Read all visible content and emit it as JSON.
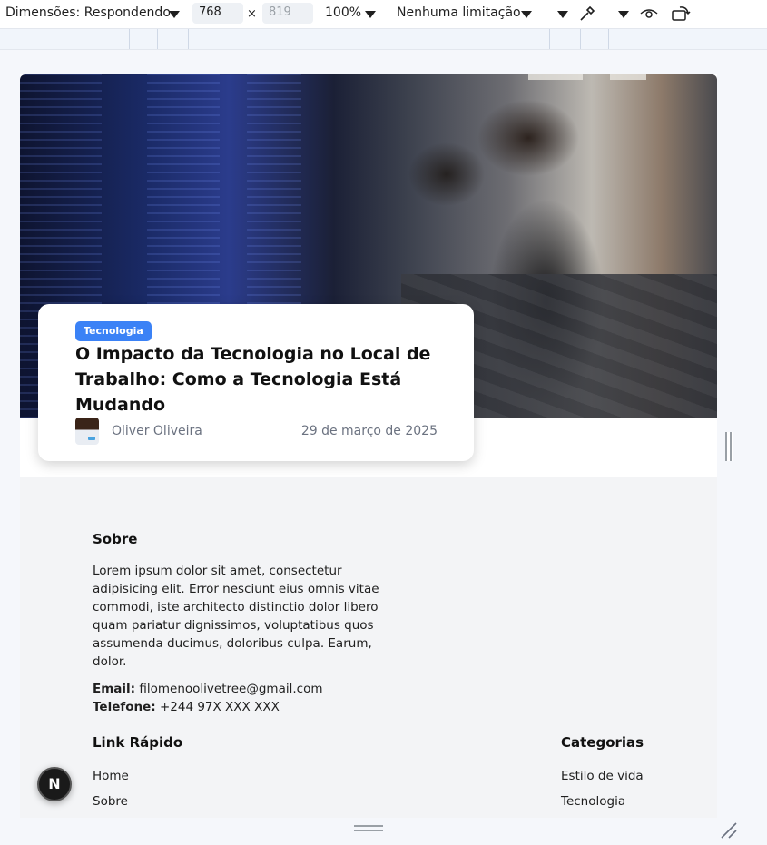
{
  "toolbar": {
    "dimensions_label": "Dimensões: Respondendo",
    "width_value": "768",
    "height_placeholder": "819",
    "times": "×",
    "zoom": "100%",
    "throttle": "Nenhuma limitação"
  },
  "article": {
    "category": "Tecnologia",
    "title": "O Impacto da Tecnologia no Local de Trabalho: Como a Tecnologia Está Mudando",
    "author": "Oliver Oliveira",
    "date": "29 de março de 2025"
  },
  "footer": {
    "about_heading": "Sobre",
    "about_text": "Lorem ipsum dolor sit amet, consectetur adipisicing elit. Error nesciunt eius omnis vitae commodi, iste architecto distinctio dolor libero quam pariatur dignissimos, voluptatibus quos assumenda ducimus, doloribus culpa. Earum, dolor.",
    "email_label": "Email:",
    "email_value": "filomenoolivetree@gmail.com",
    "phone_label": "Telefone:",
    "phone_value": "+244 97X XXX XXX",
    "quick_links_heading": "Link Rápido",
    "quick_links": [
      "Home",
      "Sobre"
    ],
    "categories_heading": "Categorias",
    "categories": [
      "Estilo de vida",
      "Tecnologia"
    ]
  },
  "next_badge": "N"
}
